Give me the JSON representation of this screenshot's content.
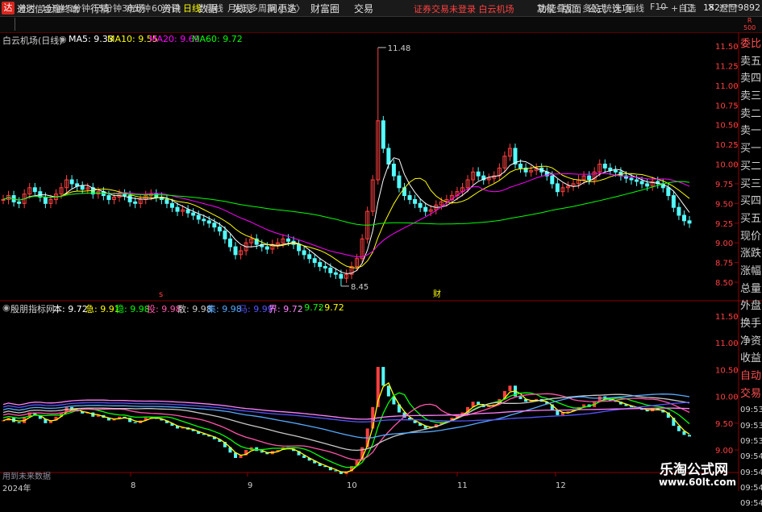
{
  "app": {
    "logo": "达",
    "title": "通达信金融终端",
    "login_status": "证券交易未登录",
    "stock_short": "白云机场",
    "user": "152****9892"
  },
  "main_menu": [
    "行情",
    "市场",
    "资讯",
    "数据",
    "发现",
    "问小达",
    "财富圈",
    "交易"
  ],
  "right_menu": [
    "功能",
    "版面",
    "公式",
    "选项"
  ],
  "window_buttons": [
    "—",
    "□",
    "✕"
  ],
  "periods": [
    "分时",
    "1分钟",
    "5分钟",
    "15分钟",
    "30分钟",
    "60分钟",
    "日线",
    "周线",
    "月线",
    "多周期",
    "更多〉"
  ],
  "active_period": "日线",
  "right_tools": [
    "复权",
    "叠加",
    "多股",
    "统计",
    "画线",
    "F10",
    "+自选",
    "返回"
  ],
  "badge": {
    "r": "R",
    "n": "500"
  },
  "main_chart": {
    "name": "白云机场(日线)",
    "indicators": [
      {
        "label": "MA5: 9.33",
        "color": "#ffffff"
      },
      {
        "label": "MA10: 9.55",
        "color": "#ffff00"
      },
      {
        "label": "MA20: 9.69",
        "color": "#ff00ff"
      },
      {
        "label": "MA60: 9.72",
        "color": "#00ff00"
      }
    ],
    "high_label": "11.48",
    "low_label": "8.45",
    "event_labels": [
      "s",
      "财"
    ]
  },
  "sub_chart": {
    "name": "殷朋指标网",
    "indicators": [
      {
        "label": "本: 9.72",
        "color": "#ffffff"
      },
      {
        "label": "急: 9.91",
        "color": "#ffff00"
      },
      {
        "label": "稳: 9.98",
        "color": "#00ff00"
      },
      {
        "label": "投: 9.98",
        "color": "#ff55aa"
      },
      {
        "label": "散: 9.98",
        "color": "#c8c8c8"
      },
      {
        "label": "集: 9.98",
        "color": "#55aaff"
      },
      {
        "label": "马: 9.99",
        "color": "#5555ff"
      },
      {
        "label": "界: 9.72",
        "color": "#ff80ff"
      },
      {
        "label": ": 9.72",
        "color": "#00ff00"
      },
      {
        "label": ": 9.72",
        "color": "#ffff00"
      }
    ]
  },
  "price_axis": [
    "11.50",
    "11.25",
    "11.00",
    "10.75",
    "10.50",
    "10.25",
    "10.00",
    "9.75",
    "9.50",
    "9.25",
    "9.00",
    "8.75",
    "8.50"
  ],
  "sub_axis": [
    "11.50",
    "11.00",
    "10.50",
    "10.00",
    "9.50",
    "9.00"
  ],
  "side_labels": [
    {
      "t": "委比",
      "red": true
    },
    {
      "t": "卖五",
      "red": false
    },
    {
      "t": "卖四",
      "red": false
    },
    {
      "t": "卖三",
      "red": false
    },
    {
      "t": "卖二",
      "red": false
    },
    {
      "t": "卖一",
      "red": false
    },
    {
      "t": "买一",
      "red": false
    },
    {
      "t": "买二",
      "red": false
    },
    {
      "t": "买三",
      "red": false
    },
    {
      "t": "买四",
      "red": false
    },
    {
      "t": "买五",
      "red": false
    },
    {
      "t": "现价",
      "red": false
    },
    {
      "t": "涨跌",
      "red": false
    },
    {
      "t": "涨幅",
      "red": false
    },
    {
      "t": "总量",
      "red": false
    },
    {
      "t": "外盘",
      "red": false
    },
    {
      "t": "换手",
      "red": false
    },
    {
      "t": "净资",
      "red": false
    },
    {
      "t": "收益",
      "red": false
    },
    {
      "t": "自动",
      "red": true
    },
    {
      "t": "交易",
      "red": true
    },
    {
      "t": "09:53",
      "red": false
    },
    {
      "t": "09:53",
      "red": false
    },
    {
      "t": "09:53",
      "red": false
    },
    {
      "t": "09:54",
      "red": false
    },
    {
      "t": "09:54",
      "red": false
    },
    {
      "t": "09:54",
      "red": false
    },
    {
      "t": "09:54",
      "red": false
    }
  ],
  "x_axis": {
    "year": "2024年",
    "months": [
      "8",
      "9",
      "10",
      "11",
      "12"
    ]
  },
  "hint": "用到未来数据",
  "watermark": {
    "line1": "乐淘公式网",
    "line2": "www.60lt.com"
  }
}
